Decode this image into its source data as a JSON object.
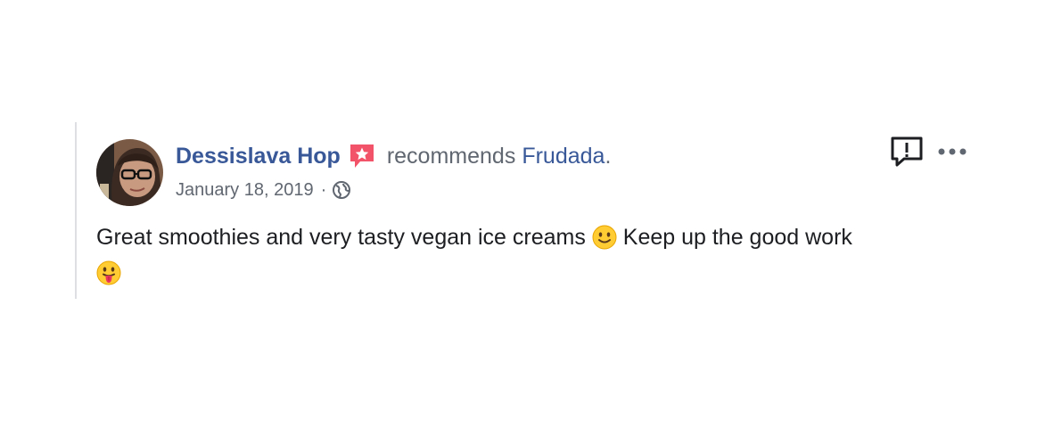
{
  "post": {
    "author": "Dessislava Hop",
    "action": "recommends",
    "page_name": "Frudada",
    "punctuation": ".",
    "date": "January 18, 2019",
    "separator": "·",
    "text_part1": "Great smoothies and very tasty vegan ice creams",
    "text_part2": "Keep up the good work",
    "emoji_1": "slightly-smiling-face",
    "emoji_2": "face-with-tongue",
    "audience_icon": "globe-icon",
    "badge_icon": "recommendation-badge-icon"
  },
  "colors": {
    "link": "#385898",
    "meta_text": "#616770",
    "body_text": "#1c1e21",
    "badge": "#f35369",
    "divider": "#dddfe2"
  }
}
